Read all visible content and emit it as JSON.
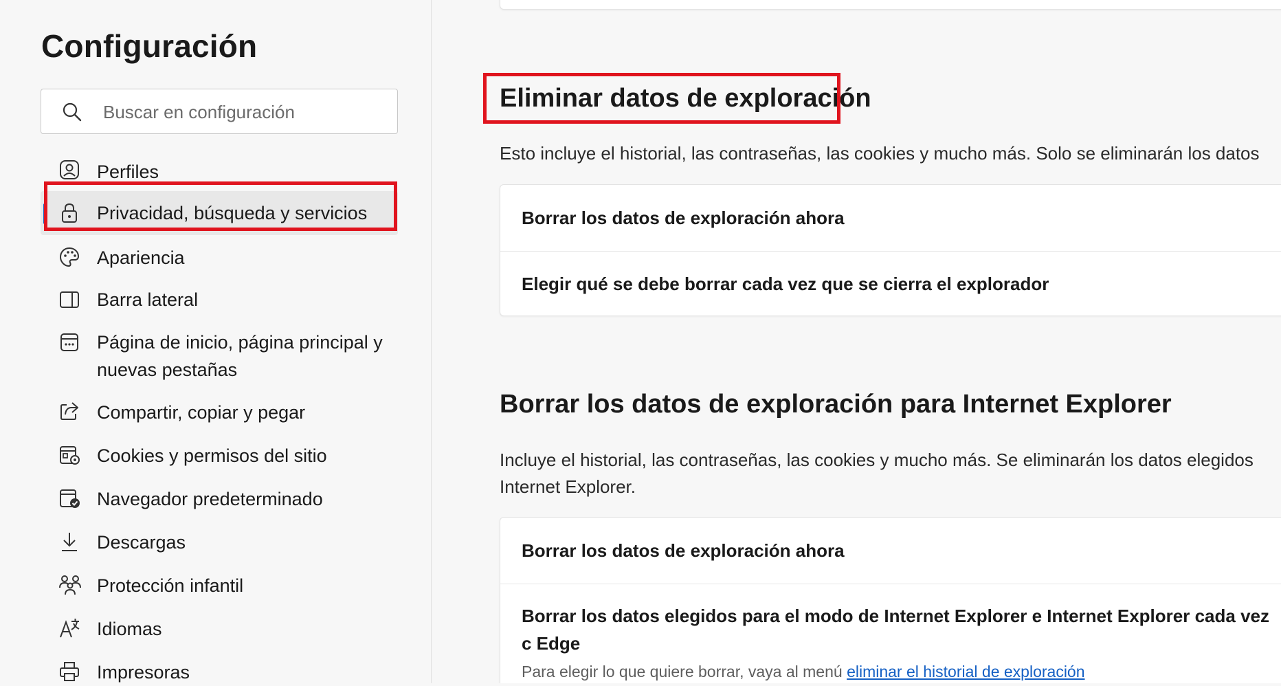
{
  "sidebar": {
    "title": "Configuración",
    "search_placeholder": "Buscar en configuración",
    "items": [
      {
        "label": "Perfiles"
      },
      {
        "label": "Privacidad, búsqueda y servicios"
      },
      {
        "label": "Apariencia"
      },
      {
        "label": "Barra lateral"
      },
      {
        "label": "Página de inicio, página principal y nuevas pestañas"
      },
      {
        "label": "Compartir, copiar y pegar"
      },
      {
        "label": "Cookies y permisos del sitio"
      },
      {
        "label": "Navegador predeterminado"
      },
      {
        "label": "Descargas"
      },
      {
        "label": "Protección infantil"
      },
      {
        "label": "Idiomas"
      },
      {
        "label": "Impresoras"
      }
    ],
    "active_item": "Privacidad, búsqueda y servicios"
  },
  "main": {
    "section1": {
      "title": "Eliminar datos de exploración",
      "description": "Esto incluye el historial, las contraseñas, las cookies y mucho más. Solo se eliminarán los datos",
      "rows": [
        {
          "label": "Borrar los datos de exploración ahora"
        },
        {
          "label": "Elegir qué se debe borrar cada vez que se cierra el explorador"
        }
      ]
    },
    "section2": {
      "title": "Borrar los datos de exploración para Internet Explorer",
      "description": "Incluye el historial, las contraseñas, las cookies y mucho más. Se eliminarán los datos elegidos Internet Explorer.",
      "rows": [
        {
          "label": "Borrar los datos de exploración ahora"
        },
        {
          "label": "Borrar los datos elegidos para el modo de Internet Explorer e Internet Explorer cada vez c Edge",
          "sub_text": "Para elegir lo que quiere borrar, vaya al menú",
          "sub_link": "eliminar el historial de exploración"
        }
      ]
    }
  },
  "colors": {
    "highlight": "#e0141e",
    "accent": "#1d62b8",
    "link": "#1560c4"
  }
}
